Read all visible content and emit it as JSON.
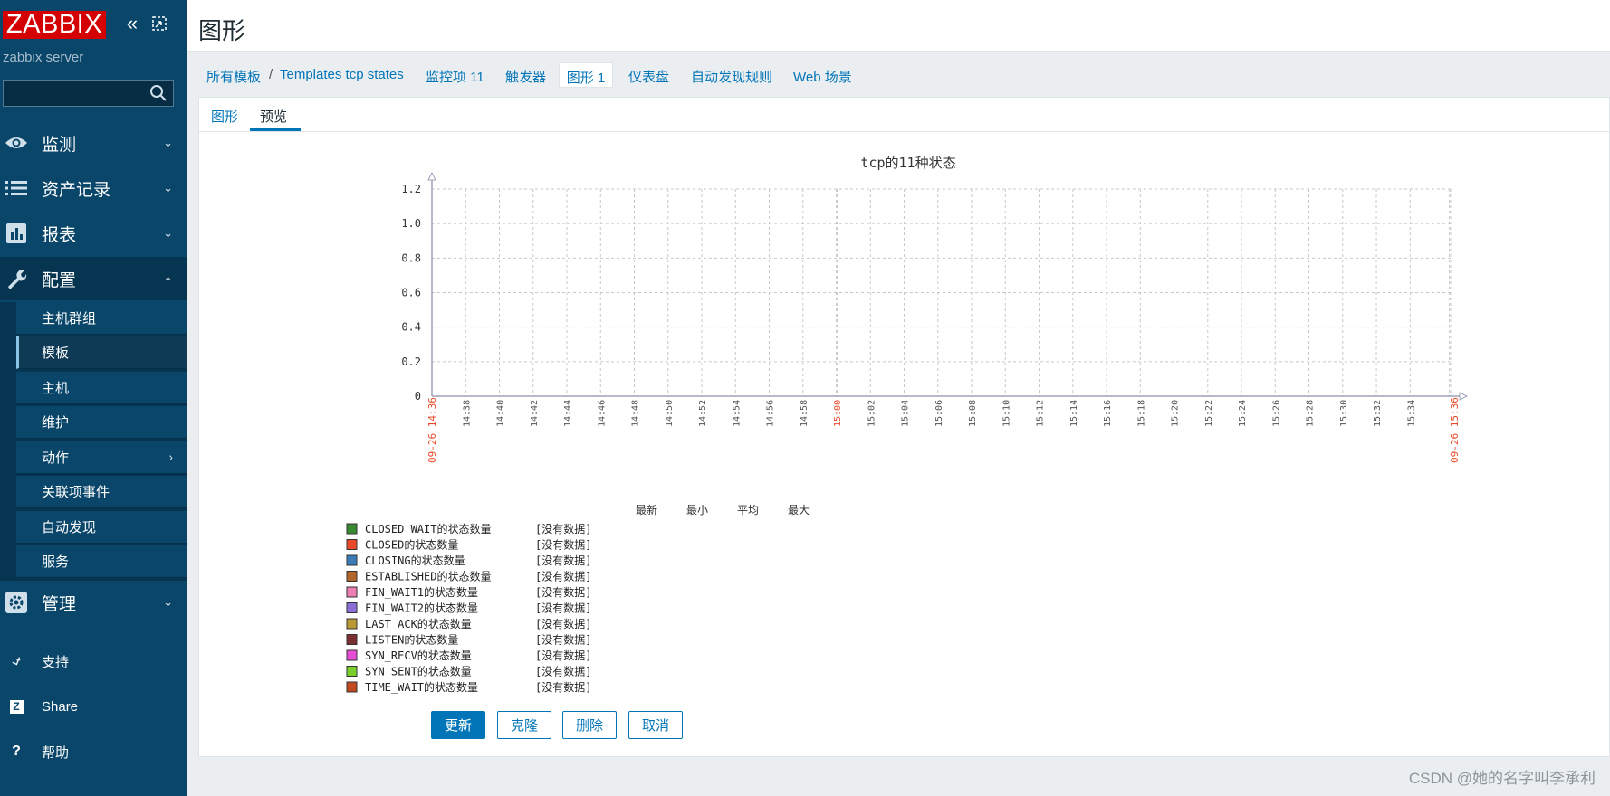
{
  "app": {
    "logo": "ZABBIX",
    "server_name": "zabbix server"
  },
  "page": {
    "title": "图形"
  },
  "sidebar": {
    "menu": [
      {
        "label": "监测",
        "icon": "eye-icon"
      },
      {
        "label": "资产记录",
        "icon": "list-icon"
      },
      {
        "label": "报表",
        "icon": "bar-chart-icon"
      },
      {
        "label": "配置",
        "icon": "wrench-icon"
      },
      {
        "label": "管理",
        "icon": "gear-icon"
      }
    ],
    "submenu": [
      "主机群组",
      "模板",
      "主机",
      "维护",
      "动作",
      "关联项事件",
      "自动发现",
      "服务"
    ],
    "footer": [
      {
        "label": "支持",
        "icon": "headset-icon"
      },
      {
        "label": "Share",
        "icon": "share-z-icon"
      },
      {
        "label": "帮助",
        "icon": "question-icon"
      }
    ]
  },
  "nav": {
    "all_templates": "所有模板",
    "separator": "/",
    "template_name": "Templates tcp states",
    "items": "监控项 11",
    "triggers": "触发器",
    "graphs": "图形 1",
    "dashboards": "仪表盘",
    "discovery": "自动发现规则",
    "web": "Web 场景"
  },
  "subtabs": {
    "graph": "图形",
    "preview": "预览"
  },
  "chart_data": {
    "type": "line",
    "title": "tcp的11种状态",
    "ylim": [
      0,
      1.2
    ],
    "y_ticks": [
      "1.2",
      "1.0",
      "0.8",
      "0.6",
      "0.4",
      "0.2",
      "0"
    ],
    "x_ticks": [
      "14:38",
      "14:40",
      "14:42",
      "14:44",
      "14:46",
      "14:48",
      "14:50",
      "14:52",
      "14:54",
      "14:56",
      "14:58",
      "15:00",
      "15:02",
      "15:04",
      "15:06",
      "15:08",
      "15:10",
      "15:12",
      "15:14",
      "15:16",
      "15:18",
      "15:20",
      "15:22",
      "15:24",
      "15:26",
      "15:28",
      "15:30",
      "15:32",
      "15:34"
    ],
    "x_start_label": "09-26 14:36",
    "x_end_label": "09-26 15:36",
    "highlight_ticks": [
      "15:00"
    ],
    "legend_headers": [
      "最新",
      "最小",
      "平均",
      "最大"
    ],
    "series": [
      {
        "name": "CLOSED_WAIT的状态数量",
        "color": "#3a8a33",
        "status": "[没有数据]"
      },
      {
        "name": "CLOSED的状态数量",
        "color": "#ea4a2a",
        "status": "[没有数据]"
      },
      {
        "name": "CLOSING的状态数量",
        "color": "#3b7fb8",
        "status": "[没有数据]"
      },
      {
        "name": "ESTABLISHED的状态数量",
        "color": "#b0652b",
        "status": "[没有数据]"
      },
      {
        "name": "FIN_WAIT1的状态数量",
        "color": "#ee7fb4",
        "status": "[没有数据]"
      },
      {
        "name": "FIN_WAIT2的状态数量",
        "color": "#8a6fd7",
        "status": "[没有数据]"
      },
      {
        "name": "LAST_ACK的状态数量",
        "color": "#b9992f",
        "status": "[没有数据]"
      },
      {
        "name": "LISTEN的状态数量",
        "color": "#7a3030",
        "status": "[没有数据]"
      },
      {
        "name": "SYN_RECV的状态数量",
        "color": "#e84dd6",
        "status": "[没有数据]"
      },
      {
        "name": "SYN_SENT的状态数量",
        "color": "#79cf2c",
        "status": "[没有数据]"
      },
      {
        "name": "TIME_WAIT的状态数量",
        "color": "#c24a22",
        "status": "[没有数据]"
      }
    ]
  },
  "buttons": {
    "update": "更新",
    "clone": "克隆",
    "delete": "删除",
    "cancel": "取消"
  },
  "watermark": "CSDN @她的名字叫李承利"
}
